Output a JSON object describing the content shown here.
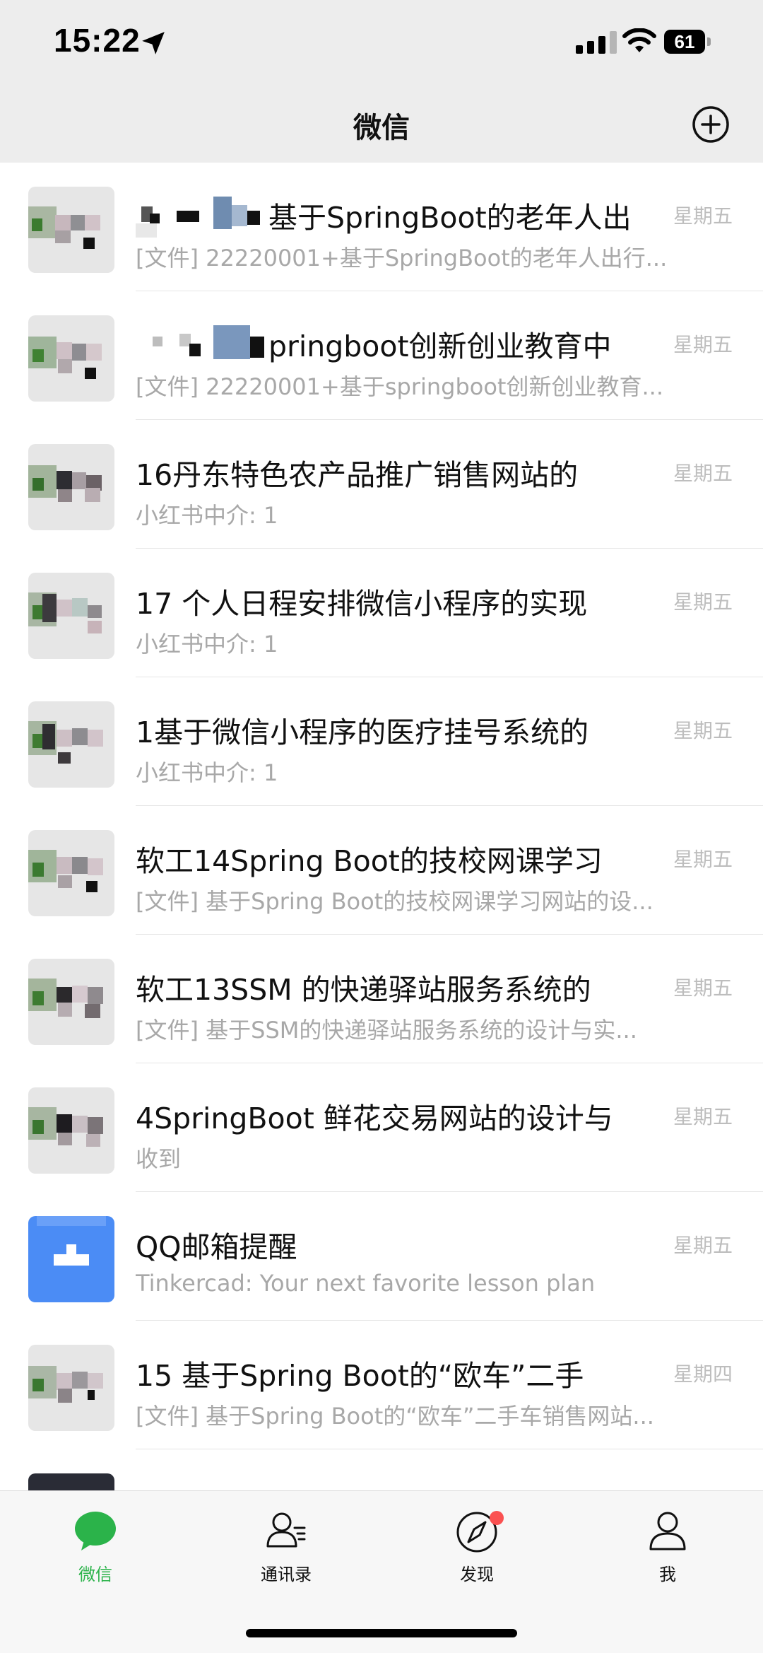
{
  "status": {
    "time": "15:22",
    "battery": "61"
  },
  "header": {
    "title": "微信"
  },
  "chats": [
    {
      "name": "基于SpringBoot的老年人出",
      "preview": "[文件] 22220001+基于SpringBoot的老年人出行...",
      "time": "星期五"
    },
    {
      "name": "pringboot创新创业教育中",
      "preview": "[文件] 22220001+基于springboot创新创业教育...",
      "time": "星期五"
    },
    {
      "name": "16丹东特色农产品推广销售网站的",
      "preview": "小红书中介: 1",
      "time": "星期五"
    },
    {
      "name": "17 个人日程安排微信小程序的实现",
      "preview": "小红书中介: 1",
      "time": "星期五"
    },
    {
      "name": "1基于微信小程序的医疗挂号系统的",
      "preview": "小红书中介: 1",
      "time": "星期五"
    },
    {
      "name": "软工14Spring Boot的技校网课学习",
      "preview": "[文件] 基于Spring Boot的技校网课学习网站的设...",
      "time": "星期五"
    },
    {
      "name": "软工13SSM 的快递驿站服务系统的",
      "preview": "[文件] 基于SSM的快递驿站服务系统的设计与实...",
      "time": "星期五"
    },
    {
      "name": "4SpringBoot 鲜花交易网站的设计与",
      "preview": "收到",
      "time": "星期五"
    },
    {
      "name": "QQ邮箱提醒",
      "preview": "Tinkercad: Your next favorite lesson plan",
      "time": "星期五"
    },
    {
      "name": "15 基于Spring Boot的“欧车”二手",
      "preview": "[文件] 基于Spring Boot的“欧车”二手车销售网站...",
      "time": "星期四"
    }
  ],
  "tabs": [
    {
      "label": "微信",
      "icon": "chat-bubble-icon",
      "active": true
    },
    {
      "label": "通讯录",
      "icon": "contacts-icon",
      "active": false
    },
    {
      "label": "发现",
      "icon": "compass-icon",
      "active": false
    },
    {
      "label": "我",
      "icon": "person-icon",
      "active": false
    }
  ],
  "colors": {
    "accent": "#2bb34a",
    "header_bg": "#ededed",
    "badge": "#fa5151"
  }
}
